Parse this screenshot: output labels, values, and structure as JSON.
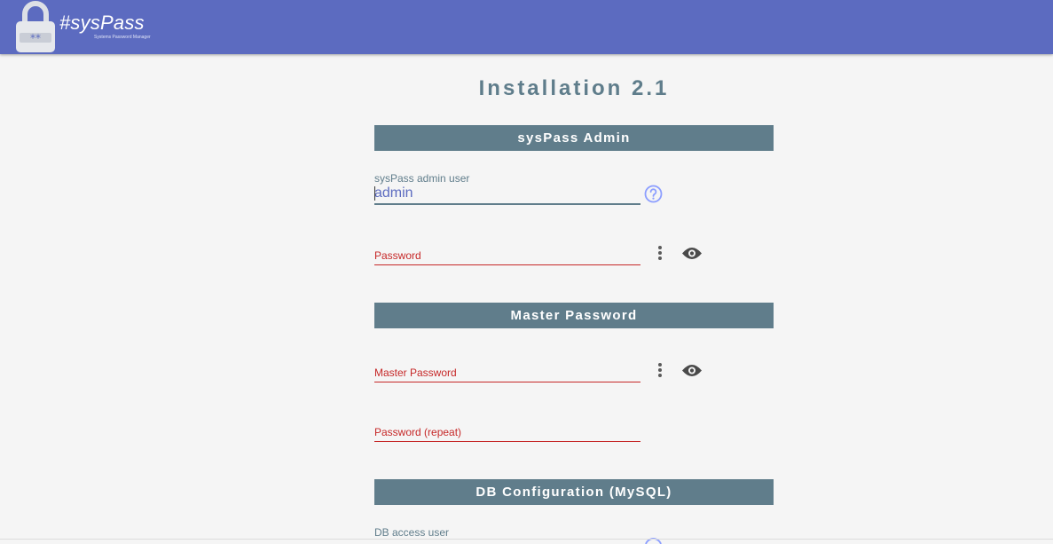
{
  "header": {
    "logo_text": "#sysPass",
    "logo_subtitle": "Systems Password Manager",
    "background_color": "#5c6bc0"
  },
  "page": {
    "title": "Installation 2.1"
  },
  "sections": {
    "admin": {
      "heading": "sysPass Admin",
      "user_label": "sysPass admin user",
      "user_value": "admin",
      "help_icon": "help-circle-icon",
      "password_label": "Password",
      "menu_icon": "more-vertical-icon",
      "visibility_icon": "eye-icon"
    },
    "master": {
      "heading": "Master Password",
      "password_label": "Master Password",
      "repeat_label": "Password (repeat)",
      "menu_icon": "more-vertical-icon",
      "visibility_icon": "eye-icon"
    },
    "db": {
      "heading": "DB Configuration (MySQL)",
      "user_label": "DB access user"
    }
  },
  "colors": {
    "section_bar": "#607d8b",
    "error": "#c62828",
    "accent": "#5c6bc0"
  }
}
